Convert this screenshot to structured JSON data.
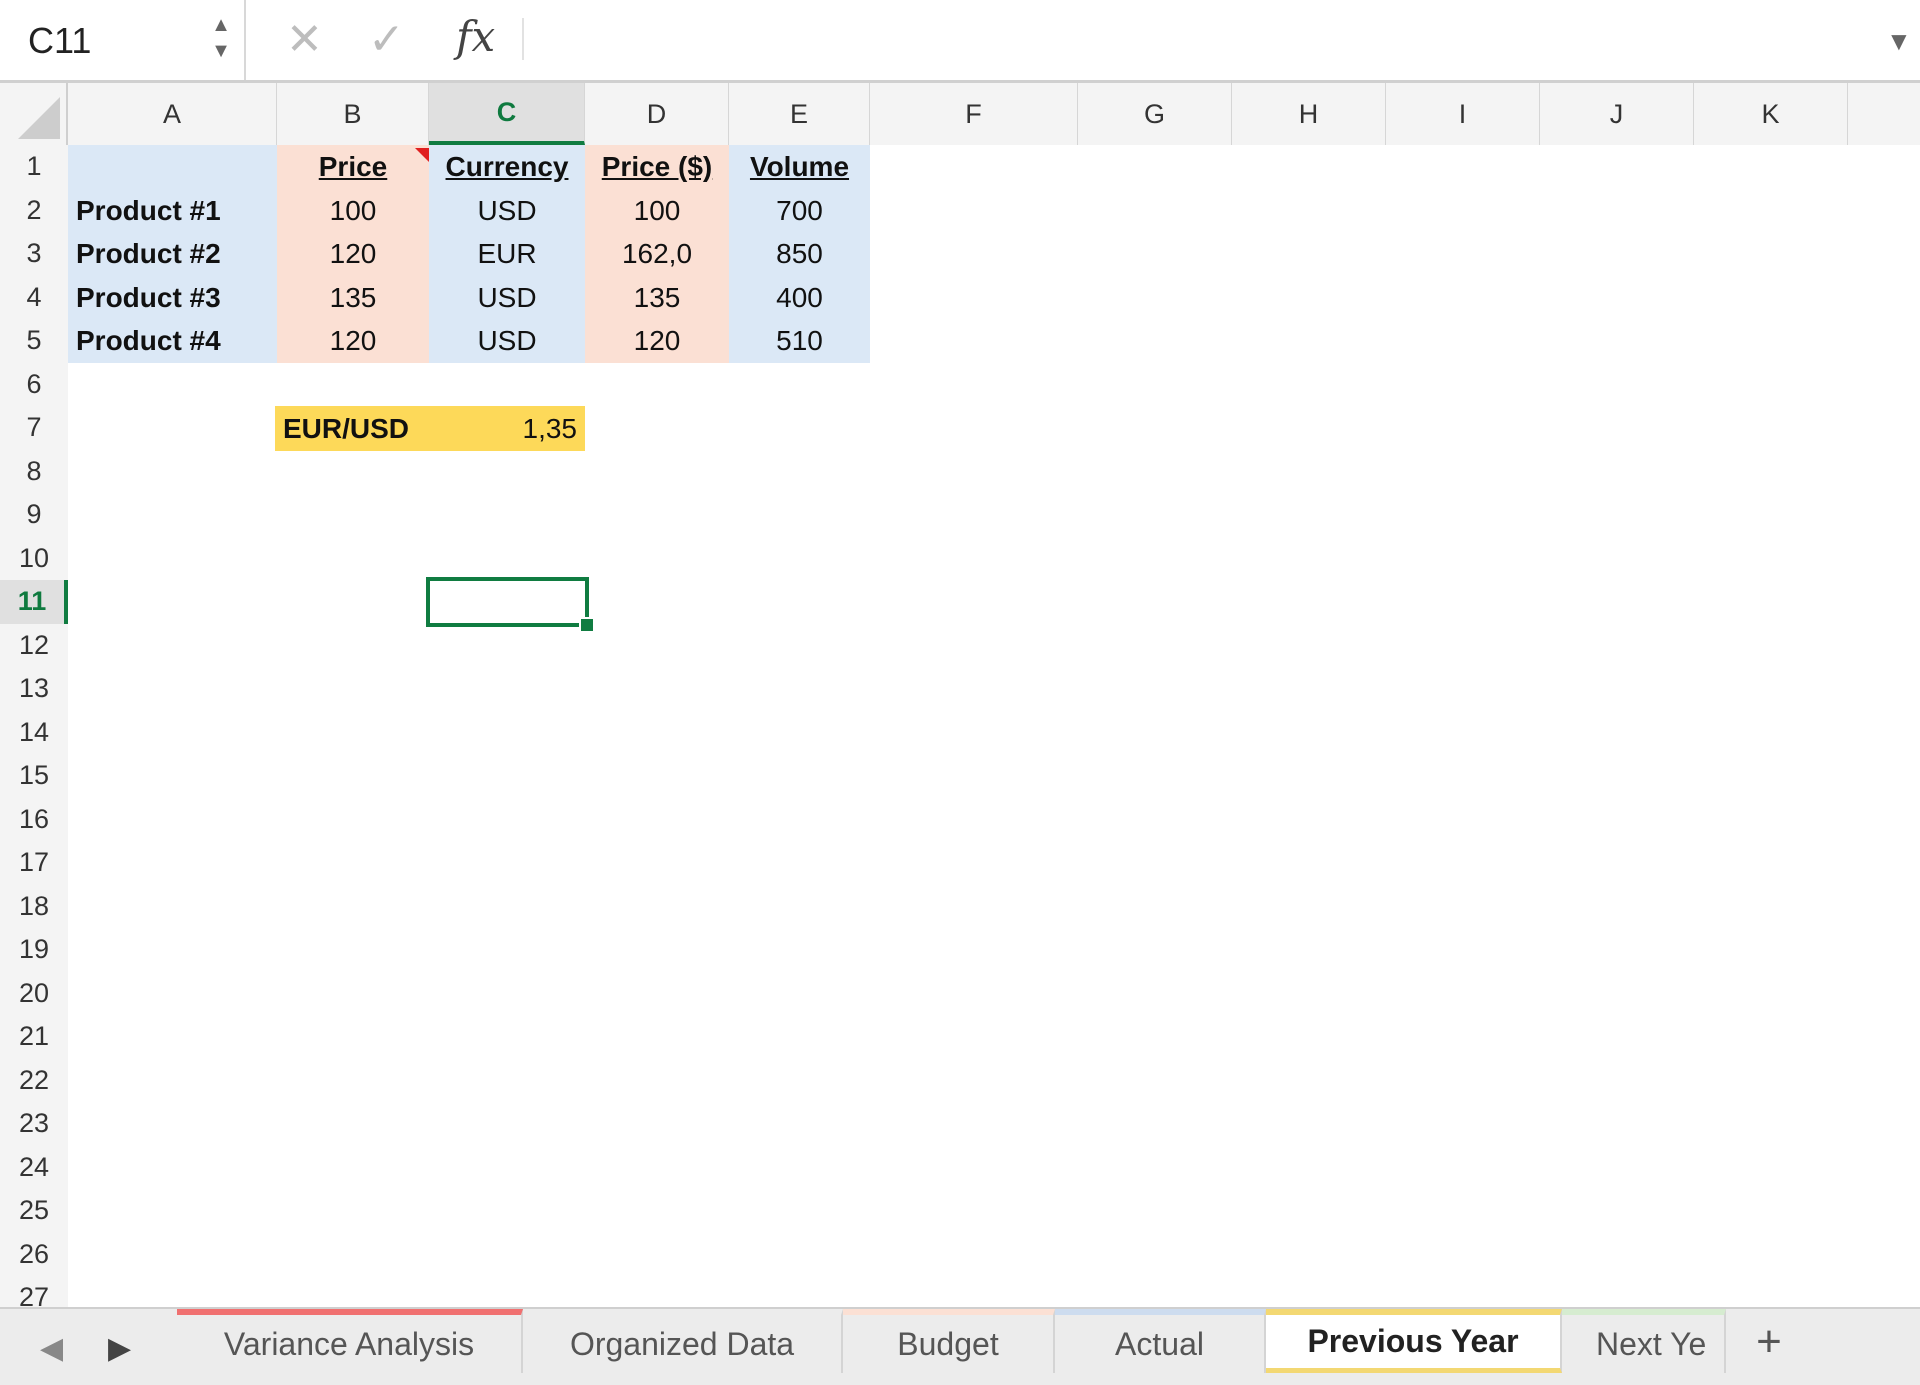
{
  "formula_bar": {
    "name_box": "C11",
    "formula": "",
    "icons": [
      "cancel-icon",
      "confirm-icon",
      "fx-icon",
      "chevron-down-icon"
    ]
  },
  "columns": [
    "A",
    "B",
    "C",
    "D",
    "E",
    "F",
    "G",
    "H",
    "I",
    "J",
    "K"
  ],
  "active_column": "C",
  "rows": [
    "1",
    "2",
    "3",
    "4",
    "5",
    "6",
    "7",
    "8",
    "9",
    "10",
    "11",
    "12",
    "13",
    "14",
    "15",
    "16",
    "17",
    "18",
    "19",
    "20",
    "21",
    "22",
    "23",
    "24",
    "25",
    "26",
    "27"
  ],
  "active_row": "11",
  "sheet": {
    "headers": {
      "price": "Price",
      "currency": "Currency",
      "price_usd": "Price ($)",
      "volume": "Volume"
    },
    "products": [
      {
        "name": "Product #1",
        "price": "100",
        "currency": "USD",
        "price_usd": "100",
        "volume": "700"
      },
      {
        "name": "Product #2",
        "price": "120",
        "currency": "EUR",
        "price_usd": "162,0",
        "volume": "850"
      },
      {
        "name": "Product #3",
        "price": "135",
        "currency": "USD",
        "price_usd": "135",
        "volume": "400"
      },
      {
        "name": "Product #4",
        "price": "120",
        "currency": "USD",
        "price_usd": "120",
        "volume": "510"
      }
    ],
    "fx_label": "EUR/USD",
    "fx_value": "1,35",
    "active_cell_value": ""
  },
  "colors": {
    "selection": "#107c41",
    "fill_blue": "#dbe8f6",
    "fill_salmon": "#fbe0d4",
    "fill_yellow": "#fdd959",
    "comment_marker": "#e02020"
  },
  "sheet_tabs": [
    {
      "label": "Variance Analysis",
      "color": "#f07070",
      "active": false
    },
    {
      "label": "Organized Data",
      "color": "",
      "active": false
    },
    {
      "label": "Budget",
      "color": "#fbe0d4",
      "active": false
    },
    {
      "label": "Actual",
      "color": "#cddcef",
      "active": false
    },
    {
      "label": "Previous Year",
      "color": "#f3d873",
      "active": true
    },
    {
      "label": "Next Ye",
      "color": "#d6ecd0",
      "active": false
    }
  ],
  "add_sheet_label": "+"
}
